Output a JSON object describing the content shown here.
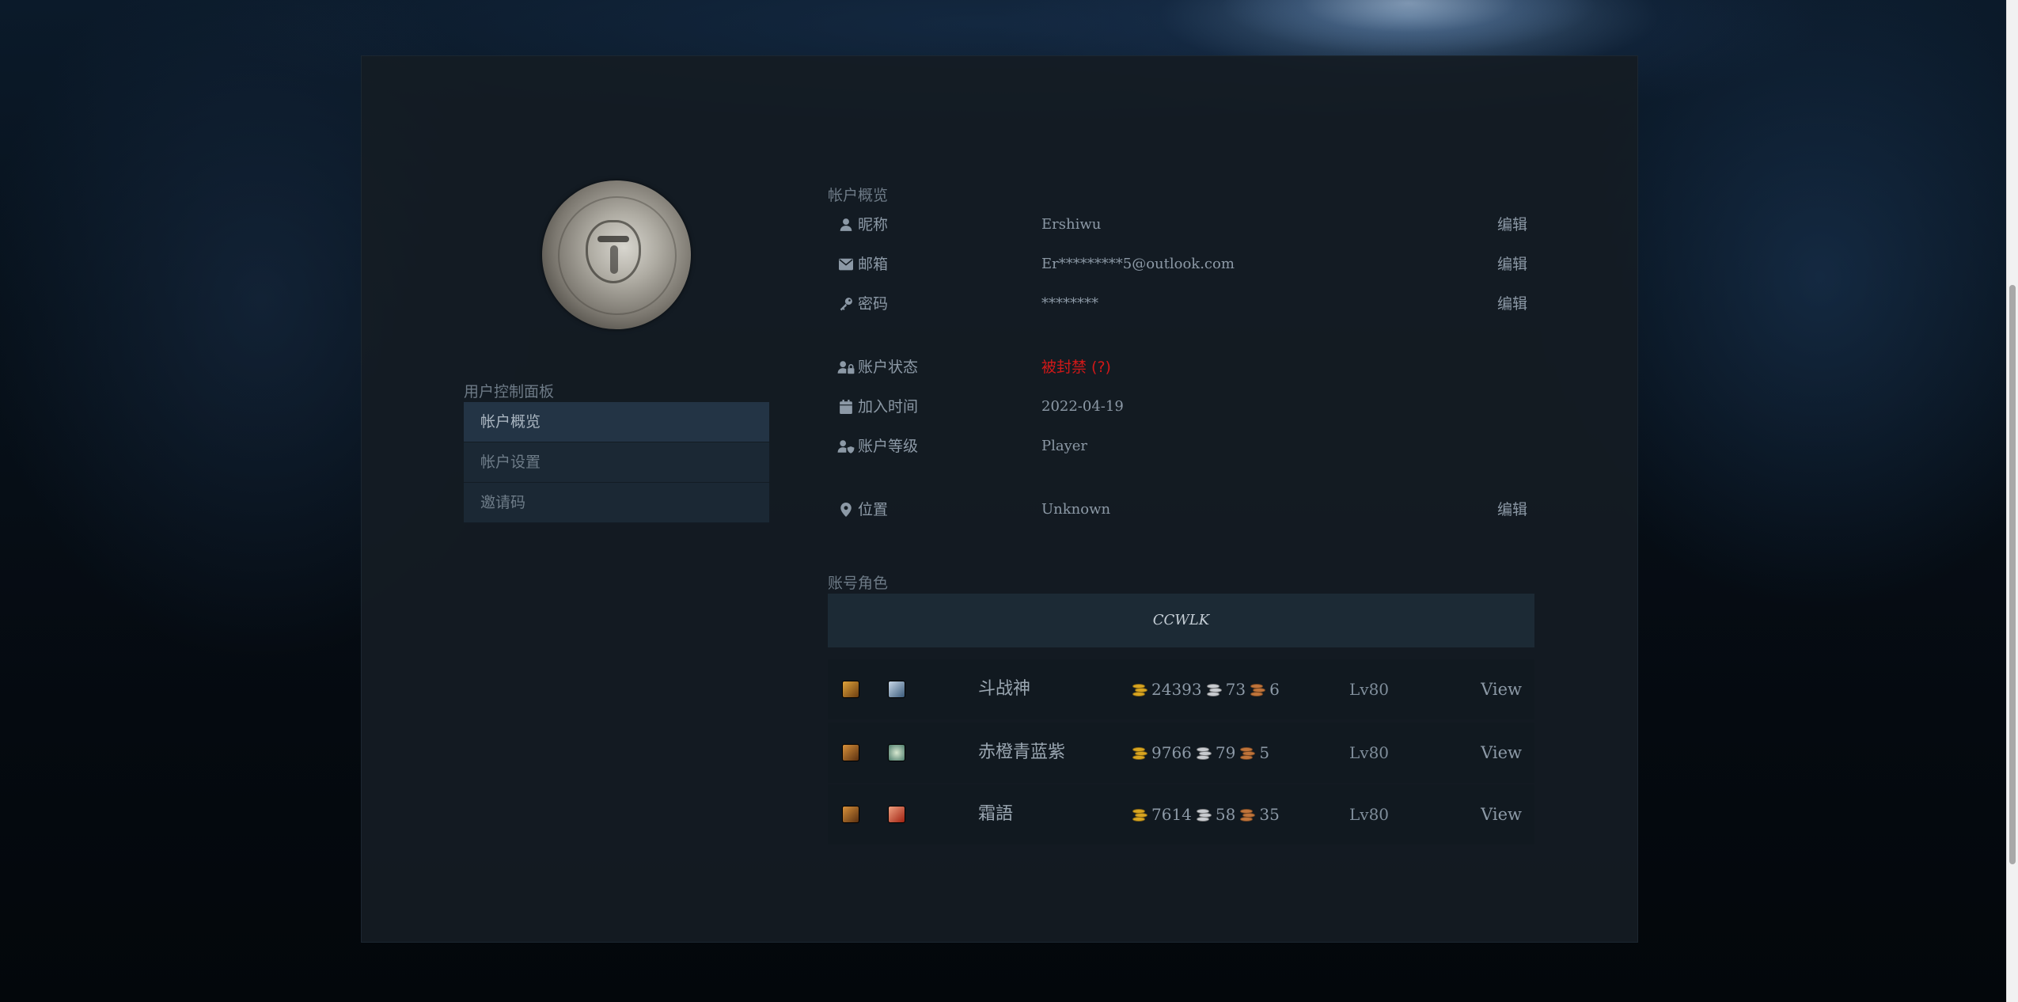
{
  "sidebar": {
    "title": "用户控制面板",
    "items": [
      {
        "label": "帐户概览",
        "active": true
      },
      {
        "label": "帐户设置",
        "active": false
      },
      {
        "label": "邀请码",
        "active": false
      }
    ]
  },
  "overview": {
    "title": "帐户概览",
    "nickname": {
      "label": "昵称",
      "value": "Ershiwu",
      "edit": "编辑",
      "icon": "user-icon"
    },
    "email": {
      "label": "邮箱",
      "value": "Er*********5@outlook.com",
      "edit": "编辑",
      "icon": "envelope-icon"
    },
    "password": {
      "label": "密码",
      "value": "********",
      "edit": "编辑",
      "icon": "key-icon"
    },
    "status": {
      "label": "账户状态",
      "value": "被封禁 (?)",
      "icon": "user-lock-icon",
      "color": "#d01818"
    },
    "joined": {
      "label": "加入时间",
      "value": "2022-04-19",
      "icon": "calendar-icon"
    },
    "level": {
      "label": "账户等级",
      "value": "Player",
      "icon": "user-shield-icon"
    },
    "location": {
      "label": "位置",
      "value": "Unknown",
      "edit": "编辑",
      "icon": "map-marker-icon"
    }
  },
  "characters": {
    "title": "账号角色",
    "realm": "CCWLK",
    "rows": [
      {
        "name": "斗战神",
        "gold": "24393",
        "silver": "73",
        "copper": "6",
        "level": "Lv80",
        "view": "View",
        "race_icon": "race-icon",
        "class_icon": "warrior-class-icon"
      },
      {
        "name": "赤橙青蓝紫",
        "gold": "9766",
        "silver": "79",
        "copper": "5",
        "level": "Lv80",
        "view": "View",
        "race_icon": "race-icon",
        "class_icon": "shaman-class-icon"
      },
      {
        "name": "霜語",
        "gold": "7614",
        "silver": "58",
        "copper": "35",
        "level": "Lv80",
        "view": "View",
        "race_icon": "race-icon",
        "class_icon": "mage-class-icon"
      }
    ]
  }
}
